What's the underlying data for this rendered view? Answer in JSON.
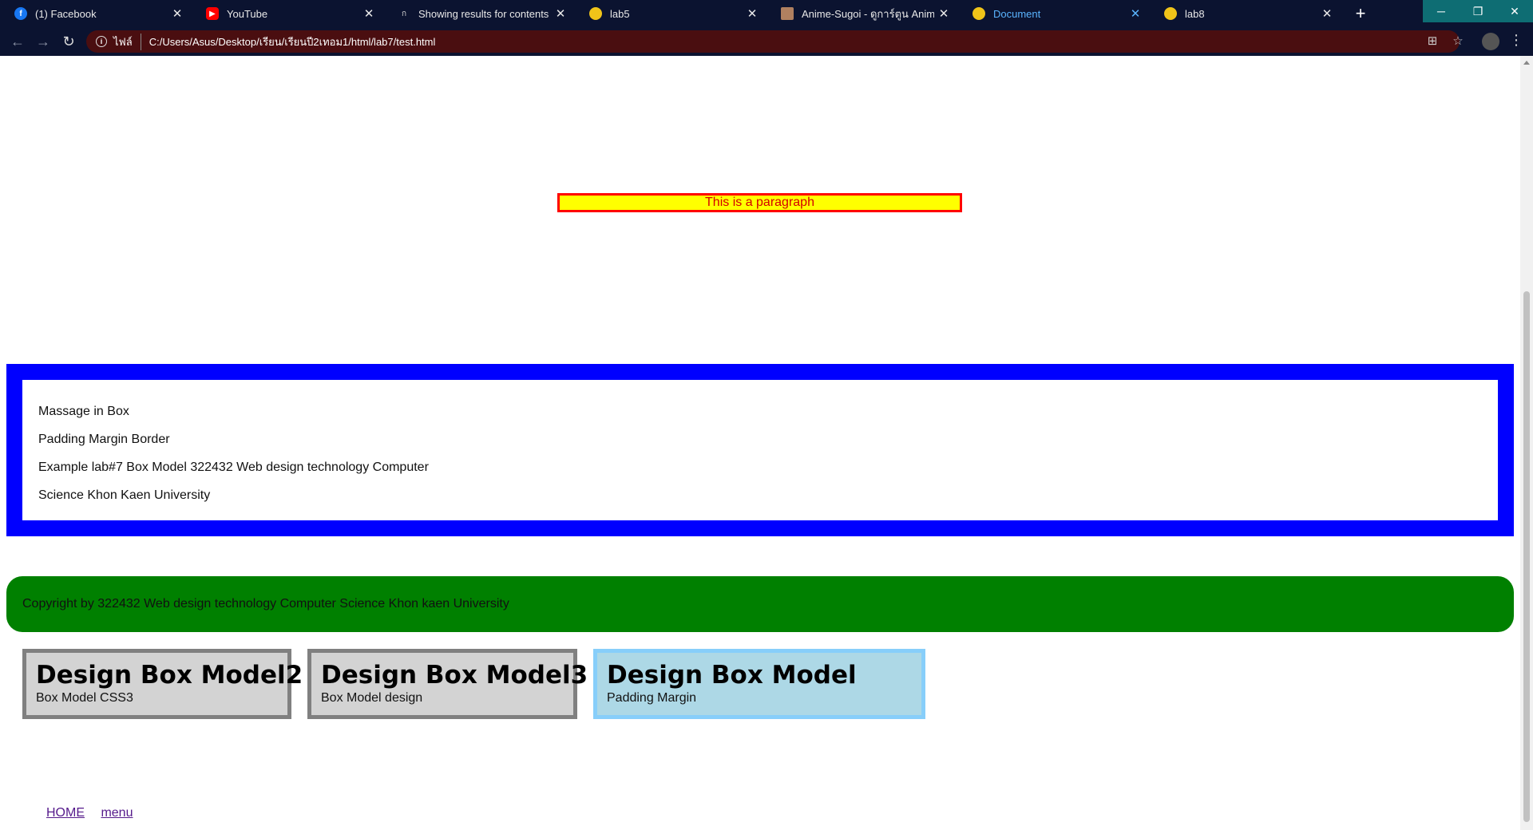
{
  "browser": {
    "tabs": [
      {
        "title": "(1) Facebook",
        "icon": "facebook-icon",
        "color": "#1877f2"
      },
      {
        "title": "YouTube",
        "icon": "youtube-icon",
        "color": "#ff0000"
      },
      {
        "title": "Showing results for contents of t",
        "icon": "translate-icon",
        "color": "#9aa0a6"
      },
      {
        "title": "lab5",
        "icon": "web-icon",
        "color": "#f0c419"
      },
      {
        "title": "Anime-Sugoi - ดูการ์ตูน Anime ดูก",
        "icon": "anime-site-icon",
        "color": "#b08060"
      },
      {
        "title": "Document",
        "icon": "web-icon",
        "color": "#f0c419"
      },
      {
        "title": "lab8",
        "icon": "web-icon",
        "color": "#f0c419"
      }
    ],
    "active_tab": 5,
    "close_glyph": "✕",
    "new_tab_glyph": "+",
    "address": {
      "scheme_label": "ไฟล์",
      "url": "C:/Users/Asus/Desktop/เรียน/เรียนปี2เทอม1/html/lab7/test.html"
    }
  },
  "page": {
    "paragraph": "This is a paragraph",
    "box_lines": [
      "Massage in Box",
      "Padding Margin Border",
      "Example lab#7 Box Model 322432 Web design technology Computer",
      "Science Khon Kaen University"
    ],
    "footer_text": "Copyright by 322432 Web design technology Computer Science Khon kaen University",
    "cards": [
      {
        "title": "Design Box Model2",
        "subtitle": "Box Model CSS3"
      },
      {
        "title": "Design Box Model3",
        "subtitle": "Box Model design"
      },
      {
        "title": "Design Box Model",
        "subtitle": "Padding Margin"
      }
    ],
    "links": [
      "HOME",
      "menu"
    ]
  },
  "colors": {
    "paragraph_bg": "#ffff00",
    "paragraph_border": "#ff0000",
    "box_border": "#0000ff",
    "footer_bg": "#008000",
    "card_bg": "#d3d3d3",
    "card_border": "#808080",
    "card_active_bg": "#add8e6",
    "card_active_border": "#87cefa"
  }
}
